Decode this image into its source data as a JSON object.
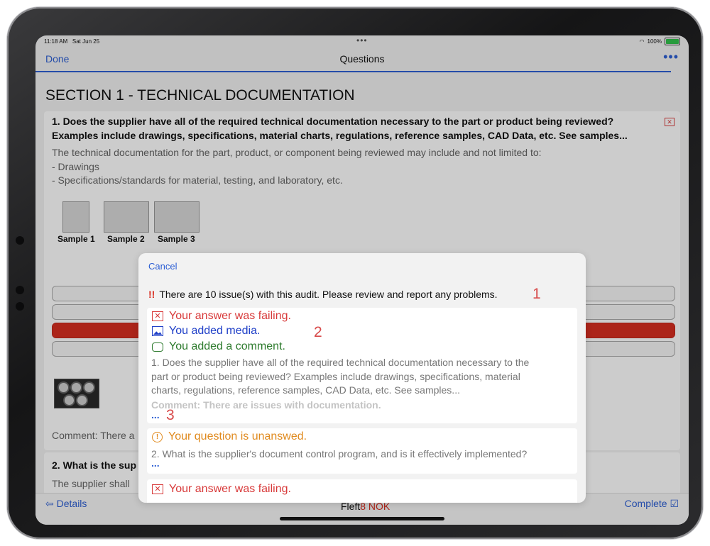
{
  "status": {
    "time": "11:18 AM",
    "date": "Sat Jun 25",
    "battery": "100%"
  },
  "nav": {
    "done": "Done",
    "title": "Questions",
    "more": "•••"
  },
  "section": {
    "title": "SECTION 1 - TECHNICAL DOCUMENTATION"
  },
  "q1": {
    "title_line1": "1. Does the supplier have all of the required technical documentation necessary to the part or product being reviewed?",
    "title_line2": "Examples include drawings, specifications, material charts, regulations, reference samples, CAD Data, etc.  See samples...",
    "desc_line1": "The technical documentation for the part, product, or component being reviewed may include and not limited to:",
    "desc_line2": "- Drawings",
    "desc_line3": "- Specifications/standards for material, testing, and laboratory, etc.",
    "samples": [
      "Sample 1",
      "Sample 2",
      "Sample 3"
    ],
    "comment": "Comment: There a"
  },
  "q2": {
    "title": "2. What is the sup",
    "desc": "The supplier shall"
  },
  "footer": {
    "details": "⇦ Details",
    "score_prefix": "Fleft",
    "score_nok": "8 NOK",
    "complete": "Complete ☑"
  },
  "modal": {
    "cancel": "Cancel",
    "issue_icon": "!!",
    "issue_text": "There are 10 issue(s) with this audit. Please review and report any problems.",
    "annotations": [
      "1",
      "2",
      "3"
    ],
    "item1": {
      "failing": "Your answer was failing.",
      "media": "You added media.",
      "comment_added": "You added a comment.",
      "q_line1": "1. Does the supplier have all of the required technical documentation necessary to the",
      "q_line2": "part or product being reviewed? Examples include drawings, specifications, material",
      "q_line3": "charts, regulations, reference samples, CAD Data, etc.  See samples...",
      "comment": "Comment: There are issues with documentation.",
      "more": "..."
    },
    "item2": {
      "unanswered": "Your question is unanswed.",
      "q_line1": "2. What is the supplier's document control program, and is it effectively implemented?",
      "more": "..."
    },
    "item3": {
      "failing": "Your answer was failing."
    }
  },
  "colors": {
    "accent": "#2d5fd4",
    "fail": "#d83a3a",
    "media": "#2040c8",
    "comment": "#2c7a2c",
    "warn": "#e08a1e"
  }
}
